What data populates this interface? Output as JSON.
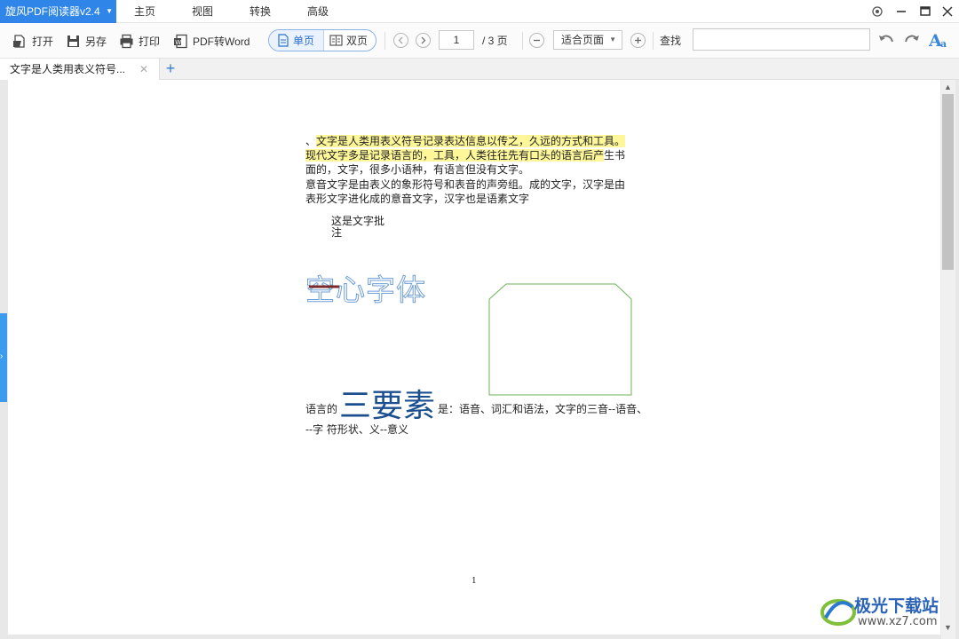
{
  "app": {
    "title": "旋风PDF阅读器v2.4",
    "accent_color": "#2f86e8",
    "menu": [
      "主页",
      "视图",
      "转换",
      "高级"
    ]
  },
  "window_controls": [
    "settings-icon",
    "minimize-icon",
    "maximize-icon",
    "close-icon"
  ],
  "toolbar": {
    "open_label": "打开",
    "save_as_label": "另存",
    "print_label": "打印",
    "pdf_to_word_label": "PDF转Word",
    "single_page_label": "单页",
    "double_page_label": "双页",
    "current_page": "1",
    "page_total": "/ 3 页",
    "zoom_value": "适合页面",
    "find_label": "查找",
    "find_placeholder": ""
  },
  "tabs": {
    "doc_tab_label": "文字是人类用表义符号..."
  },
  "document": {
    "para1_prefix": "、",
    "para1_line1_highlight": "文字是人类用表义符号记录表达信息以传之，久远的方式和工具。",
    "para1_line2_highlight": "现代文字多是记录语言的，工具，人类往往先有口头的语言后产",
    "para1_line2_rest": "生书",
    "para1_line3": "面的，文字，很多小语种，有语言但没有文字。",
    "para1_line4": "意音文字是由表义的象形符号和表音的声旁组。成的文字，汉字是由",
    "para1_line5": "表形文字进化成的意音文字，汉字也是语素文字",
    "annotation_line1": "这是文字批",
    "annotation_line2": "注",
    "outline_title": "空心字体",
    "lang_prefix": "语言的",
    "big_title": "三要素",
    "lang_suffix": "是：语音、词汇和语法，文字的三音--语音、",
    "lang_line2": "--字  符形状、义--意义",
    "page_number": "1",
    "highlight_color": "#fdf79a",
    "shape_stroke_color": "#6cb35a"
  },
  "watermark": {
    "brand": "极光下载站",
    "url": "www.xz7.com"
  }
}
